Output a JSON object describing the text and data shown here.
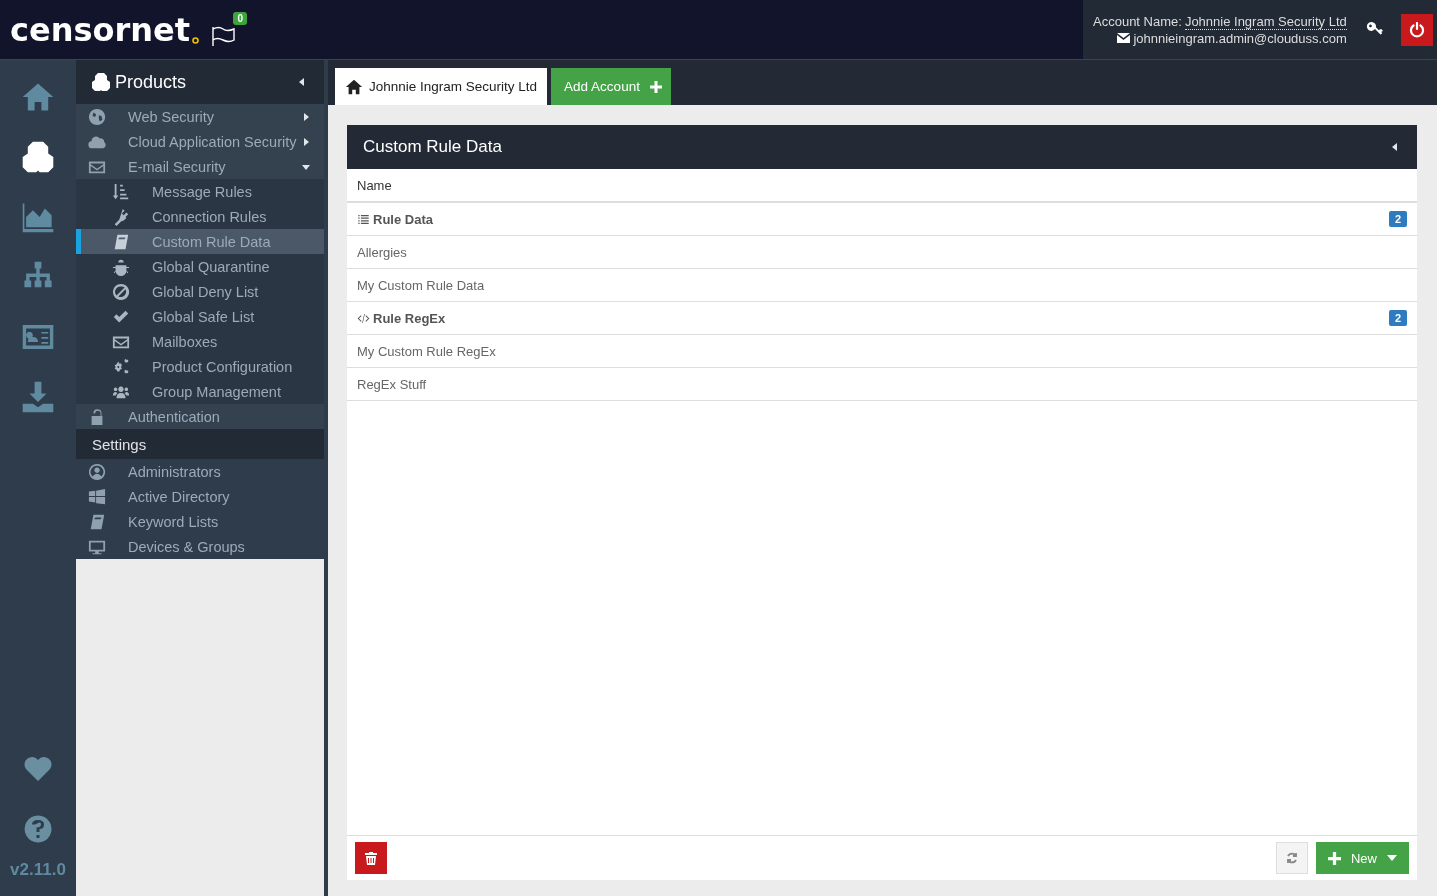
{
  "header": {
    "logo": "censornet",
    "notifications": "0",
    "account_label": "Account Name:",
    "account_name": "Johnnie Ingram Security Ltd",
    "email": "johnnieingram.admin@clouduss.com"
  },
  "rail": {
    "items": [
      {
        "selected": false
      },
      {
        "selected": true
      },
      {
        "selected": false
      },
      {
        "selected": false
      },
      {
        "selected": false
      },
      {
        "selected": false
      }
    ],
    "bottom": [
      {
        "selected": false
      },
      {
        "selected": false
      }
    ],
    "version": "v2.11.0"
  },
  "sidebar": {
    "title": "Products",
    "items": [
      {
        "label": "Web Security",
        "kind": "group",
        "expanded": false
      },
      {
        "label": "Cloud Application Security",
        "kind": "group",
        "expanded": false
      },
      {
        "label": "E-mail Security",
        "kind": "group",
        "expanded": true,
        "children": [
          {
            "label": "Message Rules",
            "selected": false
          },
          {
            "label": "Connection Rules",
            "selected": false
          },
          {
            "label": "Custom Rule Data",
            "selected": true
          },
          {
            "label": "Global Quarantine",
            "selected": false
          },
          {
            "label": "Global Deny List",
            "selected": false
          },
          {
            "label": "Global Safe List",
            "selected": false
          },
          {
            "label": "Mailboxes",
            "selected": false
          },
          {
            "label": "Product Configuration",
            "selected": false
          },
          {
            "label": "Group Management",
            "selected": false
          }
        ]
      },
      {
        "label": "Authentication",
        "kind": "link"
      }
    ],
    "settings_title": "Settings",
    "settings": [
      {
        "label": "Administrators"
      },
      {
        "label": "Active Directory"
      },
      {
        "label": "Keyword Lists"
      },
      {
        "label": "Devices & Groups"
      }
    ]
  },
  "tabs": [
    {
      "label": "Johnnie Ingram Security Ltd",
      "selected": true
    }
  ],
  "add_account": "Add Account",
  "panel": {
    "title": "Custom Rule Data",
    "column": "Name",
    "groups": [
      {
        "title": "Rule Data",
        "count": "2",
        "items": [
          "Allergies",
          "My Custom Rule Data"
        ]
      },
      {
        "title": "Rule RegEx",
        "count": "2",
        "items": [
          "My Custom Rule RegEx",
          "RegEx Stuff"
        ]
      }
    ],
    "new_button": "New"
  }
}
